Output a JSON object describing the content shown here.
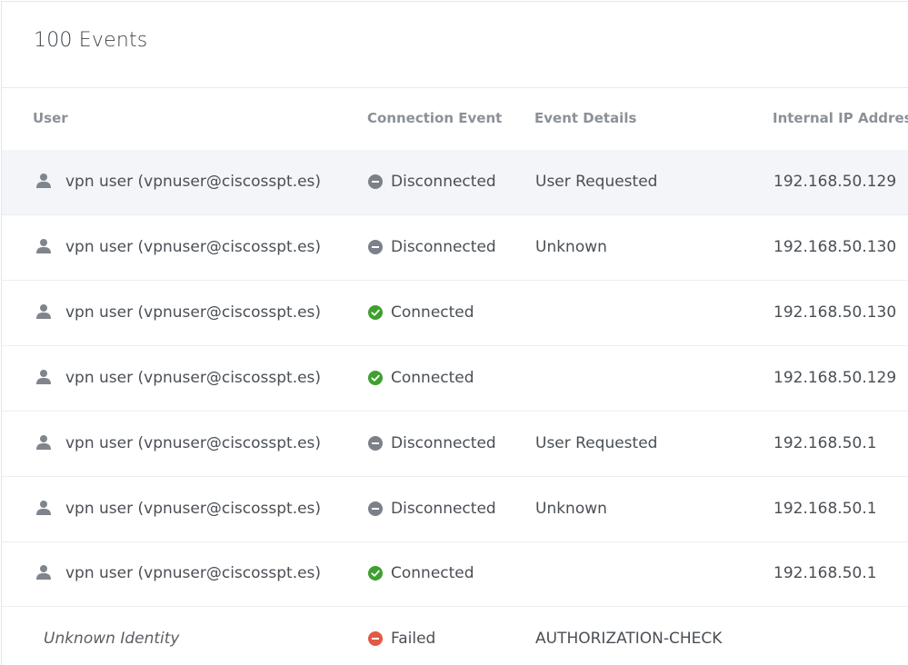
{
  "header": {
    "title": "100 Events"
  },
  "columns": {
    "user": "User",
    "event": "Connection Event",
    "details": "Event Details",
    "ip": "Internal IP Address"
  },
  "colors": {
    "disconnected": "#7b8089",
    "connected": "#3f9f2f",
    "failed": "#e05a45"
  },
  "rows": [
    {
      "user": "vpn user (vpnuser@ciscosspt.es)",
      "event": "Disconnected",
      "event_icon": "minus-circle-icon",
      "details": "User Requested",
      "ip": "192.168.50.129"
    },
    {
      "user": "vpn user (vpnuser@ciscosspt.es)",
      "event": "Disconnected",
      "event_icon": "minus-circle-icon",
      "details": "Unknown",
      "ip": "192.168.50.130"
    },
    {
      "user": "vpn user (vpnuser@ciscosspt.es)",
      "event": "Connected",
      "event_icon": "check-circle-icon",
      "details": "",
      "ip": "192.168.50.130"
    },
    {
      "user": "vpn user (vpnuser@ciscosspt.es)",
      "event": "Connected",
      "event_icon": "check-circle-icon",
      "details": "",
      "ip": "192.168.50.129"
    },
    {
      "user": "vpn user (vpnuser@ciscosspt.es)",
      "event": "Disconnected",
      "event_icon": "minus-circle-icon",
      "details": "User Requested",
      "ip": "192.168.50.1"
    },
    {
      "user": "vpn user (vpnuser@ciscosspt.es)",
      "event": "Disconnected",
      "event_icon": "minus-circle-icon",
      "details": "Unknown",
      "ip": "192.168.50.1"
    },
    {
      "user": "vpn user (vpnuser@ciscosspt.es)",
      "event": "Connected",
      "event_icon": "check-circle-icon",
      "details": "",
      "ip": "192.168.50.1"
    },
    {
      "user": "Unknown Identity",
      "event": "Failed",
      "event_icon": "minus-circle-icon",
      "details": "AUTHORIZATION-CHECK",
      "ip": ""
    }
  ]
}
